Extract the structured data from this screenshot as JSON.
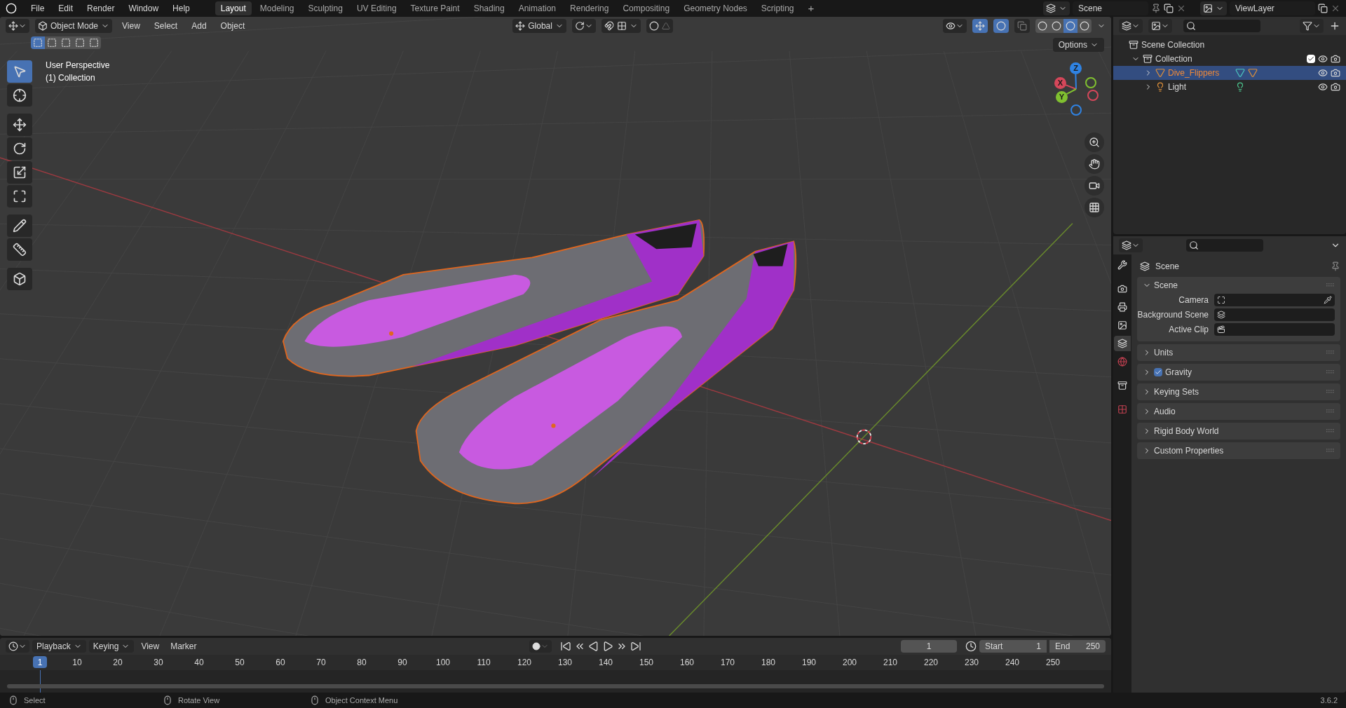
{
  "top_menu": [
    "File",
    "Edit",
    "Render",
    "Window",
    "Help"
  ],
  "workspaces": [
    {
      "label": "Layout",
      "selected": true
    },
    {
      "label": "Modeling",
      "selected": false
    },
    {
      "label": "Sculpting",
      "selected": false
    },
    {
      "label": "UV Editing",
      "selected": false
    },
    {
      "label": "Texture Paint",
      "selected": false
    },
    {
      "label": "Shading",
      "selected": false
    },
    {
      "label": "Animation",
      "selected": false
    },
    {
      "label": "Rendering",
      "selected": false
    },
    {
      "label": "Compositing",
      "selected": false
    },
    {
      "label": "Geometry Nodes",
      "selected": false
    },
    {
      "label": "Scripting",
      "selected": false
    }
  ],
  "add_workspace": "+",
  "scene_field": "Scene",
  "view_layer_field": "ViewLayer",
  "viewport": {
    "mode": "Object Mode",
    "menus": [
      "View",
      "Select",
      "Add",
      "Object"
    ],
    "orientation": "Global",
    "options": "Options",
    "select_modes": [
      {
        "selected": true
      },
      {
        "selected": false
      },
      {
        "selected": false
      },
      {
        "selected": false
      },
      {
        "selected": false
      }
    ],
    "shading_modes": [
      {
        "selected": false
      },
      {
        "selected": false
      },
      {
        "selected": true
      },
      {
        "selected": false
      }
    ],
    "tools": [
      {
        "selected": true
      },
      {
        "selected": false
      },
      {
        "selected": false
      },
      {
        "selected": false
      },
      {
        "selected": false
      },
      {
        "selected": false
      },
      {
        "selected": false
      },
      {
        "selected": false
      },
      {
        "selected": false
      }
    ],
    "overlay_text": [
      "User Perspective",
      "(1) Collection"
    ],
    "gizmo_axes": [
      {
        "label": "Z",
        "color": "#2f83e3"
      },
      {
        "label": "X",
        "color": "#d5475a"
      },
      {
        "label": "Y",
        "color": "#80c030"
      }
    ]
  },
  "outliner": {
    "root": "Scene Collection",
    "children": [
      {
        "name": "Collection",
        "checked": true,
        "expanded": true,
        "children": [
          {
            "name": "Dive_Flippers",
            "kind": "mesh",
            "selected": true,
            "expanded": false
          },
          {
            "name": "Light",
            "kind": "light",
            "selected": false,
            "expanded": false
          }
        ]
      }
    ]
  },
  "properties": {
    "title": "Scene",
    "tabs": [
      {
        "selected": false
      },
      {
        "selected": false
      },
      {
        "selected": false
      },
      {
        "selected": false
      },
      {
        "selected": true
      },
      {
        "selected": false
      },
      {
        "selected": false
      },
      {
        "selected": false
      }
    ],
    "panels": [
      {
        "title": "Scene",
        "expanded": true,
        "fields": [
          {
            "label": "Camera"
          },
          {
            "label": "Background Scene"
          },
          {
            "label": "Active Clip"
          }
        ]
      },
      {
        "title": "Units",
        "expanded": false
      },
      {
        "title": "Gravity",
        "expanded": false,
        "checked": true
      },
      {
        "title": "Keying Sets",
        "expanded": false
      },
      {
        "title": "Audio",
        "expanded": false
      },
      {
        "title": "Rigid Body World",
        "expanded": false
      },
      {
        "title": "Custom Properties",
        "expanded": false
      }
    ]
  },
  "timeline": {
    "menus": [
      "Playback",
      "Keying",
      "View",
      "Marker"
    ],
    "current_frame": "1",
    "start_label": "Start",
    "start": "1",
    "end_label": "End",
    "end": "250",
    "playhead": "1",
    "ticks": [
      "10",
      "20",
      "30",
      "40",
      "50",
      "60",
      "70",
      "80",
      "90",
      "100",
      "110",
      "120",
      "130",
      "140",
      "150",
      "160",
      "170",
      "180",
      "190",
      "200",
      "210",
      "220",
      "230",
      "240",
      "250"
    ]
  },
  "status_bar": {
    "hints": [
      "Select",
      "Rotate View",
      "Object Context Menu"
    ],
    "version": "3.6.2"
  }
}
